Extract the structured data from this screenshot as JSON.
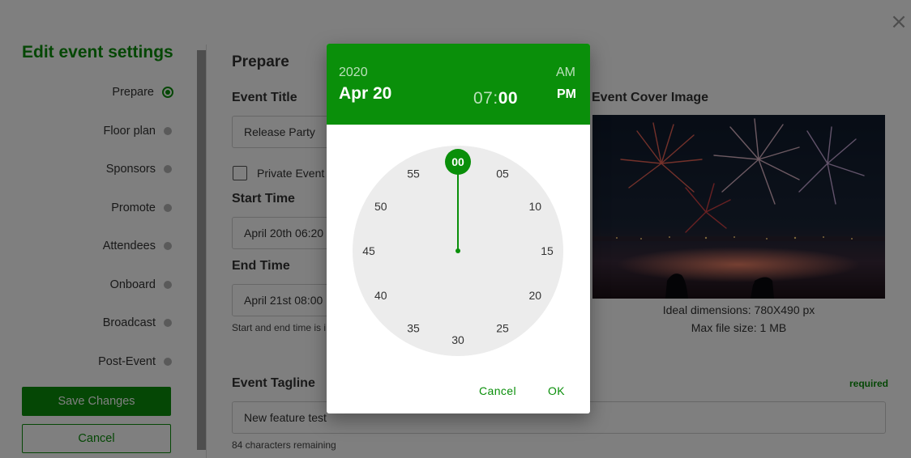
{
  "close_glyph": "×",
  "sidebar": {
    "title": "Edit event settings",
    "items": [
      {
        "label": "Prepare",
        "active": true
      },
      {
        "label": "Floor plan",
        "active": false
      },
      {
        "label": "Sponsors",
        "active": false
      },
      {
        "label": "Promote",
        "active": false
      },
      {
        "label": "Attendees",
        "active": false
      },
      {
        "label": "Onboard",
        "active": false
      },
      {
        "label": "Broadcast",
        "active": false
      },
      {
        "label": "Post-Event",
        "active": false
      }
    ],
    "save_label": "Save Changes",
    "cancel_label": "Cancel"
  },
  "form": {
    "section_title": "Prepare",
    "event_title_label": "Event Title",
    "event_title_value": "Release Party",
    "private_event_label": "Private Event",
    "start_time_label": "Start Time",
    "start_time_value": "April 20th 06:20 p",
    "end_time_label": "End Time",
    "end_time_value": "April 21st 08:00 p",
    "time_hint": "Start and end time is i",
    "cover_label": "Event Cover Image",
    "cover_dims": "Ideal dimensions: 780X490 px",
    "cover_size": "Max file size: 1 MB",
    "tagline_label": "Event Tagline",
    "tagline_required": "required",
    "tagline_value": "New feature test",
    "tagline_remaining": "84 characters remaining"
  },
  "picker": {
    "year": "2020",
    "date": "Apr 20",
    "hour": "07",
    "colon": ":",
    "minute": "00",
    "am": "AM",
    "pm": "PM",
    "selected_period": "PM",
    "minute_labels": [
      "00",
      "05",
      "10",
      "15",
      "20",
      "25",
      "30",
      "35",
      "40",
      "45",
      "50",
      "55"
    ],
    "selected_minute_index": 0,
    "cancel_label": "Cancel",
    "ok_label": "OK"
  },
  "colors": {
    "accent": "#0a8f0a",
    "clock_face": "#ececec"
  }
}
